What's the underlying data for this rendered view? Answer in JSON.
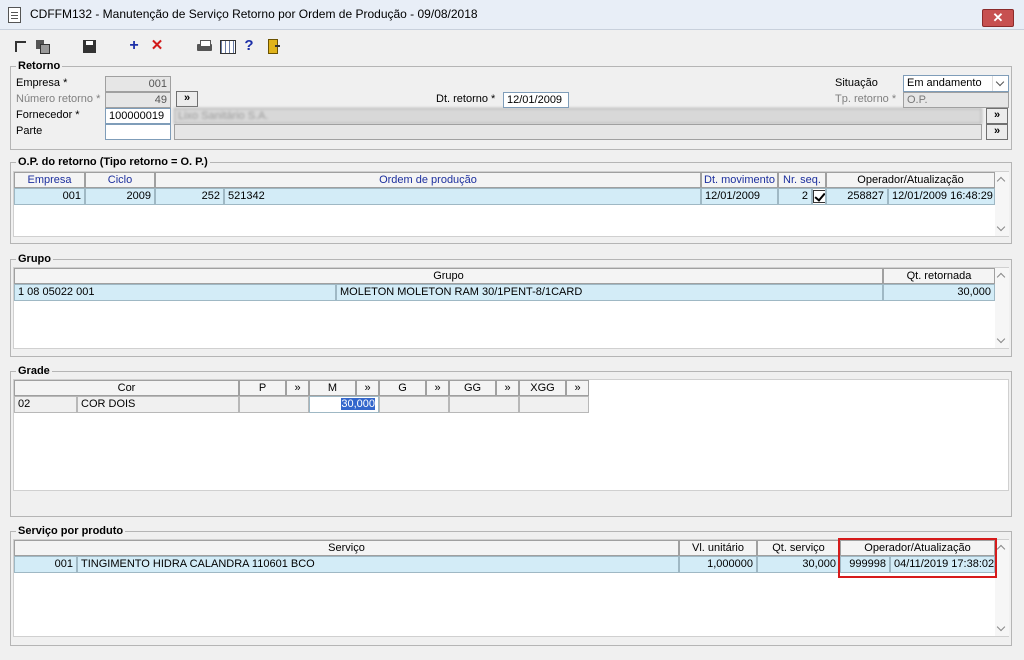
{
  "window": {
    "title": "CDFFM132 - Manutenção de Serviço Retorno por Ordem de Produção - 09/08/2018",
    "close_label": "✕"
  },
  "toolbar": {
    "add_label": "+",
    "delete_label": "✕",
    "help_label": "?"
  },
  "retorno": {
    "group_label": "Retorno",
    "empresa_label": "Empresa *",
    "empresa_value": "001",
    "numero_label": "Número retorno *",
    "numero_value": "49",
    "fornecedor_label": "Fornecedor *",
    "fornecedor_value": "100000019",
    "fornecedor_name": "Lixo Sanitário S.A.",
    "parte_label": "Parte",
    "parte_value": "",
    "dt_label": "Dt. retorno *",
    "dt_value": "12/01/2009",
    "situacao_label": "Situação",
    "situacao_value": "Em andamento",
    "tp_label": "Tp. retorno *",
    "tp_value": "O.P.",
    "lookup_label": "»"
  },
  "op": {
    "group_label": "O.P. do retorno (Tipo retorno = O. P.)",
    "headers": [
      "Empresa",
      "Ciclo",
      "Ordem de produção",
      "Dt. movimento",
      "Nr. seq.",
      "Operador/Atualização"
    ],
    "row": {
      "empresa": "001",
      "ciclo": "2009",
      "ordem_num": "252",
      "ordem_code": "521342",
      "dt_movimento": "12/01/2009",
      "nr_seq": "2",
      "operador": "258827",
      "atualizacao": "12/01/2009 16:48:29"
    }
  },
  "grupo": {
    "group_label": "Grupo",
    "headers": [
      "Grupo",
      "Qt. retornada"
    ],
    "row": {
      "code": "1 08 05022 001",
      "description": "MOLETON MOLETON RAM 30/1PENT-8/1CARD",
      "qt": "30,000"
    }
  },
  "grade": {
    "group_label": "Grade",
    "headers": [
      "Cor",
      "P",
      "M",
      "G",
      "GG",
      "XGG"
    ],
    "expand_label": "»",
    "row": {
      "cor_code": "02",
      "cor_name": "COR DOIS",
      "p": "",
      "m": "30,000",
      "g": "",
      "gg": "",
      "xgg": ""
    }
  },
  "servico": {
    "group_label": "Serviço por produto",
    "headers": [
      "Serviço",
      "Vl. unitário",
      "Qt. serviço",
      "Operador/Atualização"
    ],
    "row": {
      "code": "001",
      "description": "TINGIMENTO HIDRA CALANDRA 110601 BCO",
      "vl_unitario": "1,000000",
      "qt_servico": "30,000",
      "operador": "999998",
      "atualizacao": "04/11/2019 17:38:02"
    },
    "highlight_color": "#d61b1b"
  }
}
